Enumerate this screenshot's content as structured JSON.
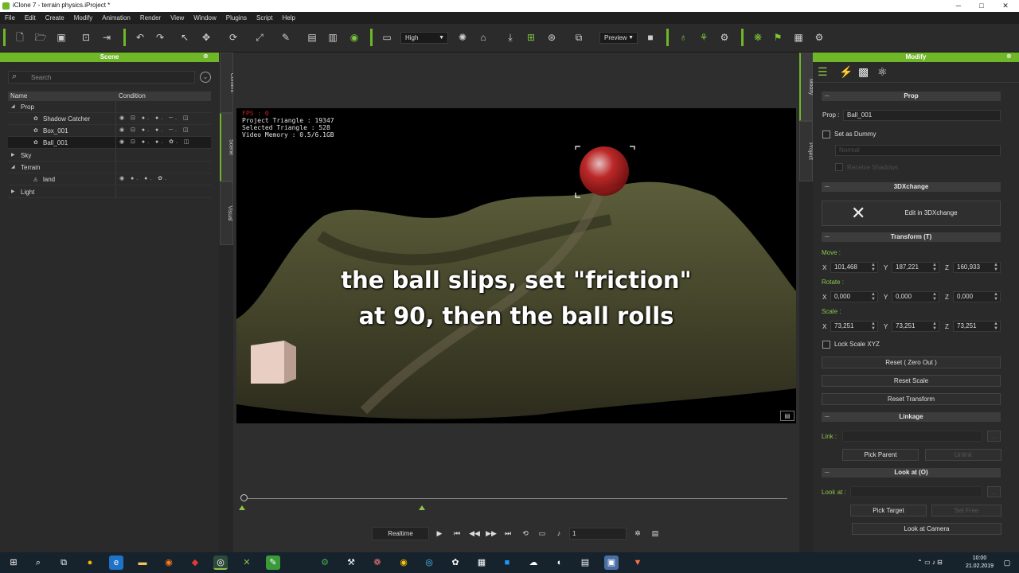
{
  "window": {
    "title": "iClone 7 - terrain physics.iProject *",
    "min": "─",
    "max": "□",
    "close": "✕"
  },
  "menu": [
    "File",
    "Edit",
    "Create",
    "Modify",
    "Animation",
    "Render",
    "View",
    "Window",
    "Plugins",
    "Script",
    "Help"
  ],
  "toolbar": {
    "quality": "High",
    "preview": "Preview"
  },
  "scene_panel": {
    "title": "Scene",
    "search_placeholder": "Search",
    "columns": {
      "name": "Name",
      "condition": "Condition"
    },
    "rows": [
      {
        "label": "Prop",
        "level": 0,
        "expanded": true
      },
      {
        "label": "Shadow Catcher",
        "level": 2
      },
      {
        "label": "Box_001",
        "level": 2
      },
      {
        "label": "Ball_001",
        "level": 2,
        "selected": true
      },
      {
        "label": "Sky",
        "level": 0,
        "expanded": false
      },
      {
        "label": "Terrain",
        "level": 0,
        "expanded": true
      },
      {
        "label": "land",
        "level": 2
      },
      {
        "label": "Light",
        "level": 0,
        "expanded": false
      }
    ]
  },
  "side_tabs": {
    "content": "Content",
    "scene": "Scene",
    "visual": "Visual",
    "modify": "Modify",
    "project": "Project"
  },
  "viewport": {
    "fps": "FPS : 0",
    "project_triangle": "Project Triangle : 19347",
    "selected_triangle": "Selected Triangle : 528",
    "video_memory": "Video Memory : 0.5/6.1GB",
    "caption_line1": "the ball slips, set \"friction\"",
    "caption_line2": "at 90, then the ball rolls"
  },
  "playback": {
    "mode": "Realtime",
    "frame": "1"
  },
  "modify_panel": {
    "title": "Modify",
    "prop_section": "Prop",
    "prop_label": "Prop :",
    "prop_value": "Ball_001",
    "set_as_dummy": "Set as Dummy",
    "normal": "Normal",
    "receive_shadows": "Receive Shadows",
    "threedx_section": "3DXchange",
    "edit_in_3dx": "Edit in 3DXchange",
    "transform_section": "Transform  (T)",
    "move_label": "Move :",
    "rotate_label": "Rotate :",
    "scale_label": "Scale :",
    "axis_x": "X",
    "axis_y": "Y",
    "axis_z": "Z",
    "move": {
      "x": "101,468",
      "y": "187,221",
      "z": "160,933"
    },
    "rotate": {
      "x": "0,000",
      "y": "0,000",
      "z": "0,000"
    },
    "scale": {
      "x": "73,251",
      "y": "73,251",
      "z": "73,251"
    },
    "lock_scale": "Lock Scale XYZ",
    "reset_zero": "Reset ( Zero Out )",
    "reset_scale": "Reset Scale",
    "reset_transform": "Reset Transform",
    "linkage_section": "Linkage",
    "link_label": "Link :",
    "pick_parent": "Pick Parent",
    "unlink": "Unlink",
    "lookat_section": "Look at  (O)",
    "lookat_label": "Look at :",
    "pick_target": "Pick Target",
    "set_free": "Set Free",
    "look_at_camera": "Look at Camera"
  },
  "taskbar": {
    "time": "10:00",
    "date": "21.02.2019"
  }
}
